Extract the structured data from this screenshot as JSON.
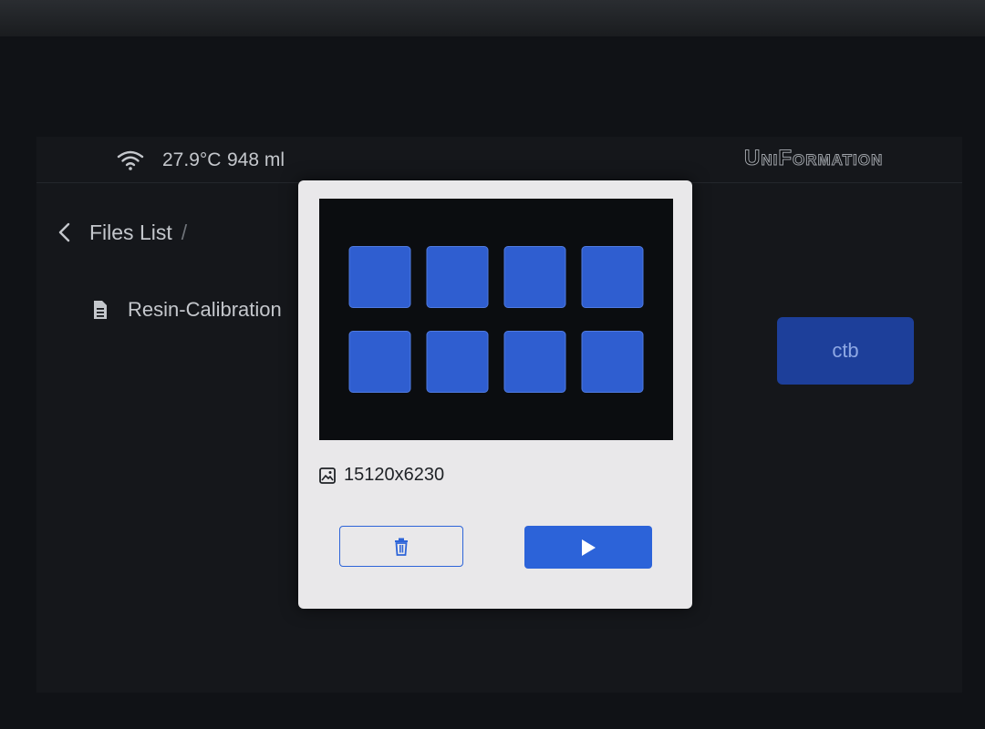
{
  "status_bar": {
    "temperature": "27.9°C",
    "resin_volume": "948 ml",
    "brand": "UniFormation",
    "wifi_icon": "wifi-icon"
  },
  "breadcrumb": {
    "back_icon": "chevron-left-icon",
    "label": "Files List",
    "separator": "/"
  },
  "file_row": {
    "icon": "file-icon",
    "name": "Resin-Calibration",
    "extension_label": "ctb"
  },
  "dialog": {
    "preview": {
      "rows": 2,
      "columns": 4,
      "tile_color": "#2f5ed0",
      "background": "#0b0d10"
    },
    "resolution_icon": "image-icon",
    "resolution": "15120x6230",
    "delete_icon": "trash-icon",
    "print_icon": "play-icon"
  },
  "colors": {
    "accent": "#2c63d9",
    "dialog_bg": "#e9e8ea",
    "screen_bg": "#15171b",
    "text_light": "#c4c7cc"
  }
}
